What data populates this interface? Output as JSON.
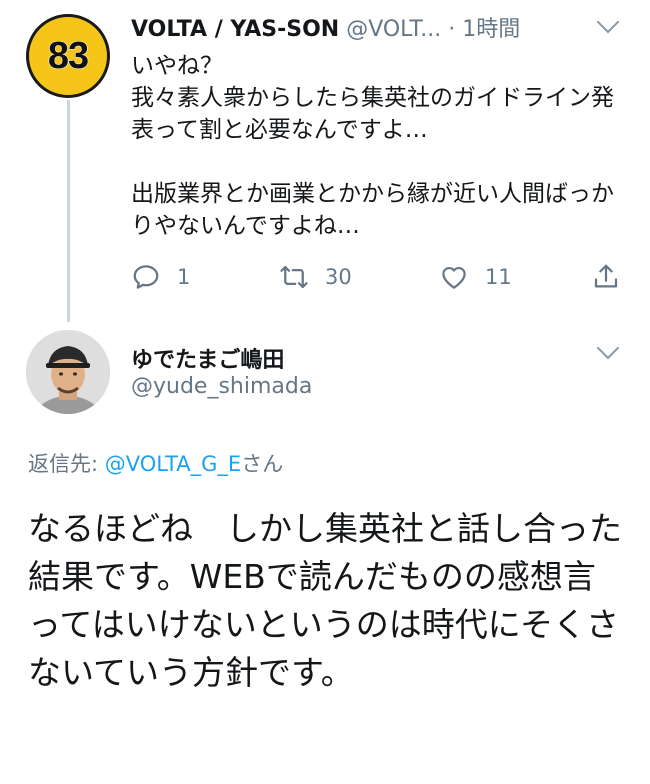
{
  "tweet1": {
    "avatar_text": "83",
    "name": "VOLTA / YAS-SON",
    "handle": "@VOLT...",
    "separator": "·",
    "time": "1時間",
    "body": "いやね？\n我々素人衆からしたら集英社のガイドライン発表って割と必要なんですよ…\n\n出版業界とか画業とかから縁が近い人間ばっかりやないんですよね…",
    "actions": {
      "reply_count": "1",
      "retweet_count": "30",
      "like_count": "11"
    }
  },
  "tweet2": {
    "name": "ゆでたまご嶋田",
    "handle": "@yude_shimada",
    "reply_prefix": "返信先: ",
    "reply_to": "@VOLTA_G_E",
    "reply_suffix": "さん",
    "body": "なるほどね　しかし集英社と話し合った結果です。WEBで読んだものの感想言ってはいけないというのは時代にそくさないていう方針です。"
  },
  "colors": {
    "link": "#1da1f2",
    "secondary_text": "#657786",
    "thread_line": "#ccd6dd",
    "avatar_yellow": "#f5c518"
  },
  "icons": [
    "reply-icon",
    "retweet-icon",
    "like-icon",
    "share-icon",
    "chevron-down-icon"
  ]
}
